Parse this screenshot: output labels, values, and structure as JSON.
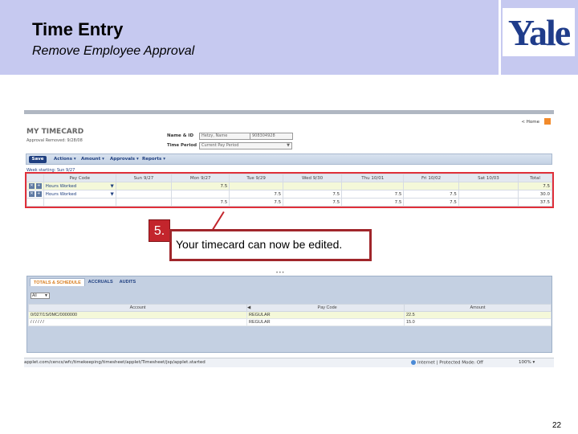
{
  "slide": {
    "title": "Time Entry",
    "subtitle": "Remove Employee Approval",
    "logo": "Yale",
    "page_number": "22"
  },
  "app": {
    "home_link": "< Home",
    "title": "MY TIMECARD",
    "approval_status": "Approval Removed: 9/28/08",
    "name_label": "Name & ID",
    "name_value": "Hetzy, Name",
    "id_value": "908304928",
    "period_label": "Time Period",
    "period_value": "Current Pay Period",
    "save_label": "Save",
    "menus": [
      "Actions ▾",
      "Amount ▾",
      "Approvals ▾",
      "Reports ▾"
    ],
    "week_label": "Week starting: Sun 9/27"
  },
  "timecard": {
    "headers": [
      "",
      "Pay Code",
      "Sun 9/27",
      "Mon 9/27",
      "Tue 9/29",
      "Wed 9/30",
      "Thu 10/01",
      "Fri 10/02",
      "Sat 10/03",
      "Total"
    ],
    "rows": [
      {
        "pay_code": "Hours Worked",
        "values": [
          "",
          "7.5",
          "",
          "",
          "",
          "",
          ""
        ],
        "total": "7.5"
      },
      {
        "pay_code": "Hours Worked",
        "values": [
          "",
          "",
          "7.5",
          "7.5",
          "7.5",
          "7.5",
          ""
        ],
        "total": "30.0"
      }
    ],
    "totals": [
      "",
      "7.5",
      "7.5",
      "7.5",
      "7.5",
      "7.5",
      ""
    ],
    "grand_total": "37.5"
  },
  "callout": {
    "step": "5.",
    "text": "Your timecard can now be edited."
  },
  "bottom_panel": {
    "tabs": [
      "TOTALS & SCHEDULE",
      "ACCRUALS",
      "AUDITS"
    ],
    "filter_value": "All",
    "columns": [
      "Account",
      "Pay Code",
      "Amount"
    ],
    "rows": [
      {
        "account": "0/027/1S/0MC/0000000",
        "pay_code": "REGULAR",
        "amount": "22.5"
      },
      {
        "account": "/ / / / / /",
        "pay_code": "REGULAR",
        "amount": "15.0"
      }
    ]
  },
  "status_bar": {
    "url": "applet.com/cencs/wfc/timekeeping/timesheet/applet/Timesheet/jsp/applet.started",
    "zone": "Internet | Protected Mode: Off",
    "zoom": "100% ▾"
  }
}
